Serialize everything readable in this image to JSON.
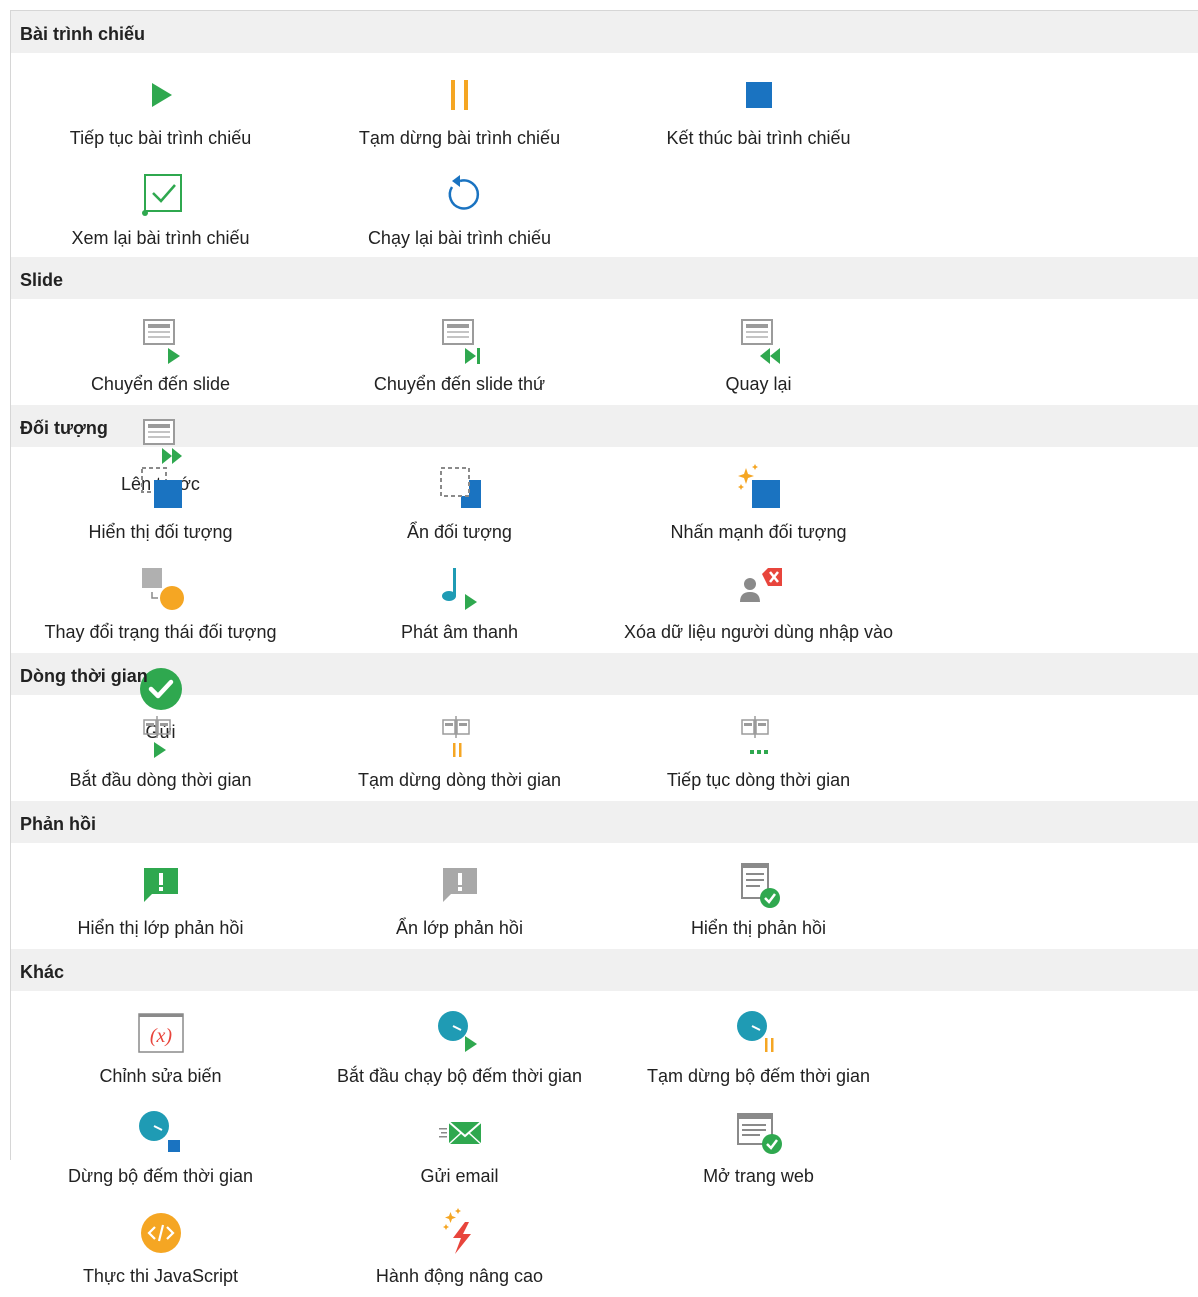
{
  "colors": {
    "green": "#2fa84f",
    "orange": "#f5a623",
    "blue": "#1a73c1",
    "teal": "#1f9bb4",
    "gray": "#9b9b9b",
    "red": "#e8453c",
    "header_bg": "#f0f0f0"
  },
  "sections": {
    "slideshow": {
      "title": "Bài trình chiếu",
      "items": [
        {
          "label": "Tiếp tục bài trình chiếu",
          "icon": "play-icon"
        },
        {
          "label": "Tạm dừng bài trình chiếu",
          "icon": "pause-icon"
        },
        {
          "label": "Kết thúc bài trình chiếu",
          "icon": "stop-icon"
        },
        {
          "label": "Xem lại bài trình chiếu",
          "icon": "review-checkbox-icon"
        },
        {
          "label": "Chạy lại bài trình chiếu",
          "icon": "replay-icon"
        }
      ]
    },
    "slide": {
      "title": "Slide",
      "items": [
        {
          "label": "Chuyển đến slide",
          "icon": "slide-goto-icon"
        },
        {
          "label": "Chuyển đến slide thứ",
          "icon": "slide-goto-number-icon"
        },
        {
          "label": "Quay lại",
          "icon": "slide-previous-icon"
        },
        {
          "label": "Lên trước",
          "icon": "slide-next-icon"
        }
      ]
    },
    "objects": {
      "title": "Đối tượng",
      "items": [
        {
          "label": "Hiển thị đối tượng",
          "icon": "show-object-icon"
        },
        {
          "label": "Ẩn đối tượng",
          "icon": "hide-object-icon"
        },
        {
          "label": "Nhấn mạnh đối tượng",
          "icon": "emphasize-object-icon"
        },
        {
          "label": "Thay đổi trạng thái đối tượng",
          "icon": "change-state-icon"
        },
        {
          "label": "Phát âm thanh",
          "icon": "play-audio-icon"
        },
        {
          "label": "Xóa dữ liệu người dùng nhập vào",
          "icon": "clear-user-input-icon"
        },
        {
          "label": "Gửi",
          "icon": "submit-check-icon"
        }
      ]
    },
    "timeline": {
      "title": "Dòng thời gian",
      "items": [
        {
          "label": "Bắt đầu dòng thời gian",
          "icon": "timeline-start-icon"
        },
        {
          "label": "Tạm dừng dòng thời gian",
          "icon": "timeline-pause-icon"
        },
        {
          "label": "Tiếp tục dòng thời gian",
          "icon": "timeline-resume-icon"
        }
      ]
    },
    "feedback": {
      "title": "Phản hồi",
      "items": [
        {
          "label": "Hiển thị lớp phản hồi",
          "icon": "show-feedback-layer-icon"
        },
        {
          "label": "Ẩn lớp phản hồi",
          "icon": "hide-feedback-layer-icon"
        },
        {
          "label": "Hiển thị phản hồi",
          "icon": "show-feedback-icon"
        }
      ]
    },
    "other": {
      "title": "Khác",
      "items": [
        {
          "label": "Chỉnh sửa biến",
          "icon": "edit-variable-icon"
        },
        {
          "label": "Bắt đầu chạy bộ đếm thời gian",
          "icon": "timer-start-icon"
        },
        {
          "label": "Tạm dừng bộ đếm thời gian",
          "icon": "timer-pause-icon"
        },
        {
          "label": "Dừng bộ đếm thời gian",
          "icon": "timer-stop-icon"
        },
        {
          "label": "Gửi email",
          "icon": "send-email-icon"
        },
        {
          "label": "Mở trang web",
          "icon": "open-webpage-icon"
        },
        {
          "label": "Thực thi JavaScript",
          "icon": "execute-javascript-icon"
        },
        {
          "label": "Hành động nâng cao",
          "icon": "advanced-action-icon"
        }
      ]
    }
  }
}
